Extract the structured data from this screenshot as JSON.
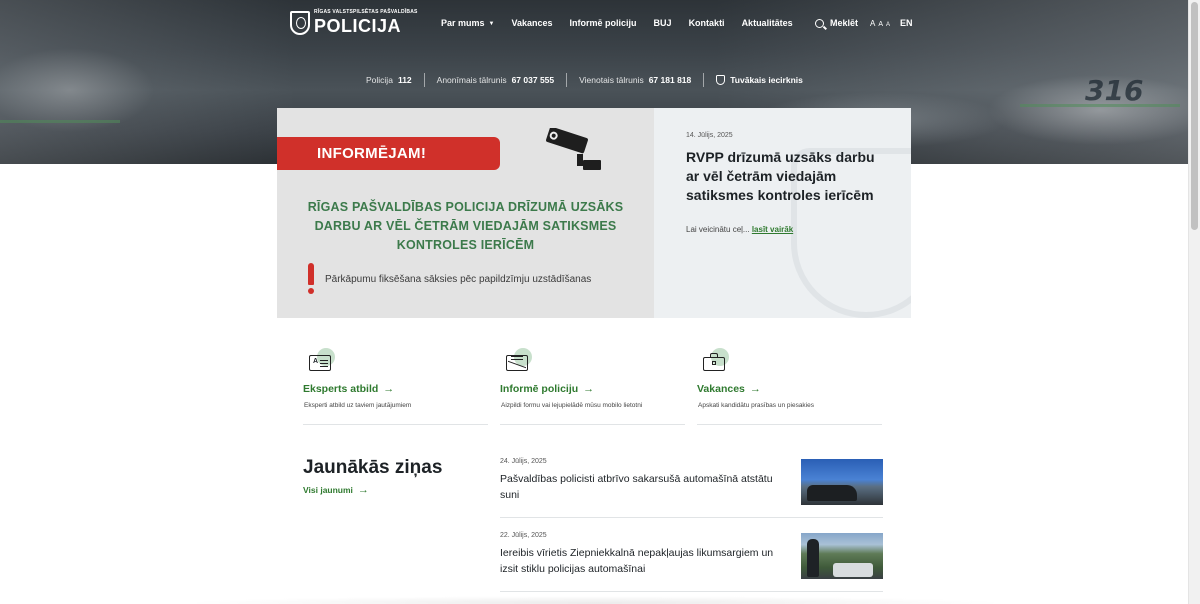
{
  "header": {
    "logo_small": "RĪGAS VALSTSPILSĒTAS PAŠVALDĪBAS",
    "logo_big": "POLICIJA",
    "nav": [
      {
        "label": "Par mums",
        "has_dropdown": true
      },
      {
        "label": "Vakances"
      },
      {
        "label": "Informē policiju"
      },
      {
        "label": "BUJ"
      },
      {
        "label": "Kontakti"
      },
      {
        "label": "Aktualitātes"
      }
    ],
    "search_label": "Meklēt",
    "font_sizes": [
      "A",
      "A",
      "A"
    ],
    "lang": "EN"
  },
  "hero": {
    "car_number": "316"
  },
  "contacts": [
    {
      "label": "Policija",
      "number": "112"
    },
    {
      "label": "Anonīmais tālrunis",
      "number": "67 037 555"
    },
    {
      "label": "Vienotais tālrunis",
      "number": "67 181 818"
    }
  ],
  "nearest_label": "Tuvākais iecirknis",
  "featured": {
    "banner": "INFORMĒJAM!",
    "image_headline": "RĪGAS PAŠVALDĪBAS POLICIJA DRĪZUMĀ UZSĀKS DARBU AR VĒL ČETRĀM VIEDAJĀM SATIKSMES KONTROLES IERĪCĒM",
    "image_note": "Pārkāpumu fiksēšana sāksies pēc papildzīmju uzstādīšanas",
    "date": "14. Jūlijs, 2025",
    "title": "RVPP drīzumā uzsāks darbu ar vēl četrām viedajām satiksmes kontroles ierīcēm",
    "lead": "Lai veicinātu ceļ...",
    "read_more": "lasīt vairāk"
  },
  "quick_links": [
    {
      "title": "Eksperts atbild",
      "desc": "Eksperti atbild uz taviem jautājumiem",
      "icon": "chat-icon"
    },
    {
      "title": "Informē policiju",
      "desc": "Aizpildi formu vai lejupielādē mūsu mobilo lietotni",
      "icon": "mail-icon"
    },
    {
      "title": "Vakances",
      "desc": "Apskati kandidātu prasības un piesakies",
      "icon": "briefcase-icon"
    }
  ],
  "latest": {
    "title": "Jaunākās ziņas",
    "all_label": "Visi jaunumi",
    "items": [
      {
        "date": "24. Jūlijs, 2025",
        "title": "Pašvaldības policisti atbrīvo sakarsušā automašīnā atstātu suni"
      },
      {
        "date": "22. Jūlijs, 2025",
        "title": "Iereibis vīrietis Ziepniekkalnā nepakļaujas likumsargiem un izsit stiklu policijas automašīnai"
      }
    ]
  },
  "colors": {
    "accent": "#2f7a2f",
    "banner_red": "#d0302a",
    "headline_green": "#3c7a4b"
  }
}
